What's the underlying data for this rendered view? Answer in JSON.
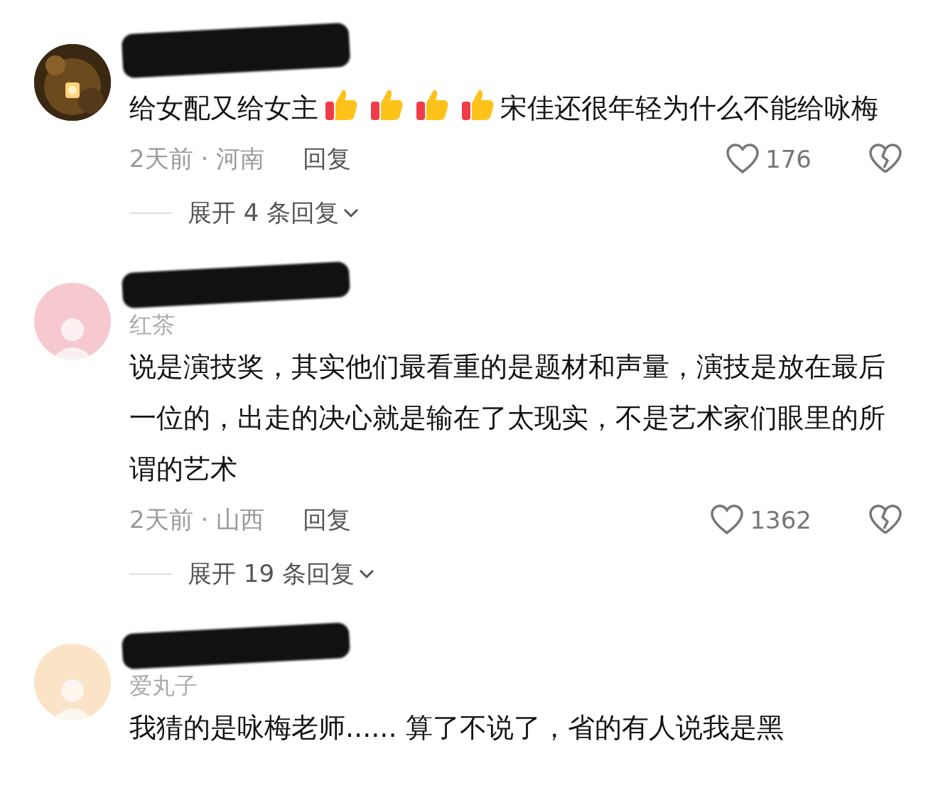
{
  "comments": [
    {
      "redacted": true,
      "body": [
        {
          "kind": "text",
          "text": "给女配又给女主"
        },
        {
          "kind": "thumbs"
        },
        {
          "kind": "thumbs"
        },
        {
          "kind": "thumbs"
        },
        {
          "kind": "thumbs"
        },
        {
          "kind": "text",
          "text": "宋佳还很年轻为什么不能给咏梅"
        }
      ],
      "meta": "2天前 · 河南",
      "reply": "回复",
      "likes": "176",
      "expand": "展开 4 条回复"
    },
    {
      "avatar": {
        "kind": "plain",
        "color": "#f6c9cf"
      },
      "name": "红茶",
      "redacted": true,
      "body": [
        {
          "kind": "text",
          "text": "说是演技奖，其实他们最看重的是题材和声量，演技是放在最后一位的，出走的决心就是输在了太现实，不是艺术家们眼里的所谓的艺术"
        }
      ],
      "meta": "2天前 · 山西",
      "reply": "回复",
      "likes": "1362",
      "expand": "展开 19 条回复"
    },
    {
      "avatar": {
        "kind": "plain",
        "color": "#fbe3c8"
      },
      "name": "爱丸子",
      "redacted": true,
      "body": [
        {
          "kind": "text",
          "text": "我猜的是咏梅老师...... 算了不说了，省的有人说我是黑"
        }
      ]
    }
  ]
}
